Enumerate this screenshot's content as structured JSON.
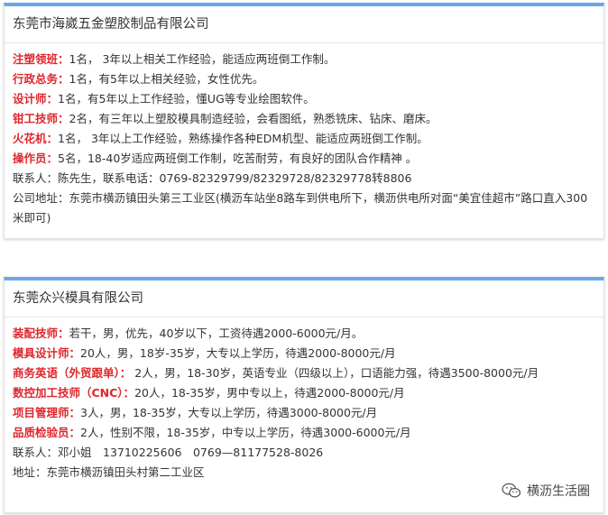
{
  "companies": [
    {
      "name": "东莞市海崴五金塑胶制品有限公司",
      "jobs": [
        {
          "label": "注塑领班：",
          "text": "1名， 3年以上相关工作经验，能适应两班倒工作制。"
        },
        {
          "label": "行政总务：",
          "text": "1名，有5年以上相关经验，女性优先。"
        },
        {
          "label": "设计师：",
          "text": "1名，有5年以上工作经验，懂UG等专业绘图软件。"
        },
        {
          "label": "钳工技师：",
          "text": "2名，有三年以上塑胶模具制造经验，会看图纸，熟悉铣床、钻床、磨床。"
        },
        {
          "label": "火花机：",
          "text": "1名， 3年以上工作经验，熟练操作各种EDM机型、能适应两班倒工作制。"
        },
        {
          "label": "操作员：",
          "text": "5名，18-40岁适应两班倒工作制，吃苦耐劳，有良好的团队合作精神 。"
        }
      ],
      "info": [
        "联系人：陈先生，联系电话：0769-82329799/82329728/82329778转8806",
        "公司地址：东莞市横沥镇田头第三工业区(横沥车站坐8路车到供电所下，横沥供电所对面“美宜佳超市”路口直入300米即可)"
      ]
    },
    {
      "name": "东莞众兴模具有限公司",
      "jobs": [
        {
          "label": "装配技师：",
          "text": "若干，男，优先，40岁以下，工资待遇2000-6000元/月。"
        },
        {
          "label": "模具设计师：",
          "text": "20人，男，18岁-35岁，大专以上学历，待遇2000-8000元/月"
        },
        {
          "label": "商务英语（外贸跟单）：",
          "text": " 2人，男，18-30岁，英语专业（四级以上），口语能力强，待遇3500-8000元/月"
        },
        {
          "label": "数控加工技师（CNC）：",
          "text": "20人，18-35岁，男中专以上，待遇2000-8000元/月"
        },
        {
          "label": "项目管理师：",
          "text": "3人，男，18-35岁，大专以上学历，待遇3000-8000元/月"
        },
        {
          "label": "品质检验员：",
          "text": "2人，性别不限，18-35岁，中专以上学历，待遇3000-6000元/月"
        }
      ],
      "info": [
        "联系人：邓小姐　13710225606　0769—81177528-8026",
        "地址：东莞市横沥镇田头村第二工业区"
      ]
    }
  ],
  "watermark": {
    "text": "横沥生活圈",
    "icon": "wechat-icon"
  },
  "colors": {
    "accent": "#6aa7ea",
    "label": "#e0262c",
    "text": "#333333"
  }
}
